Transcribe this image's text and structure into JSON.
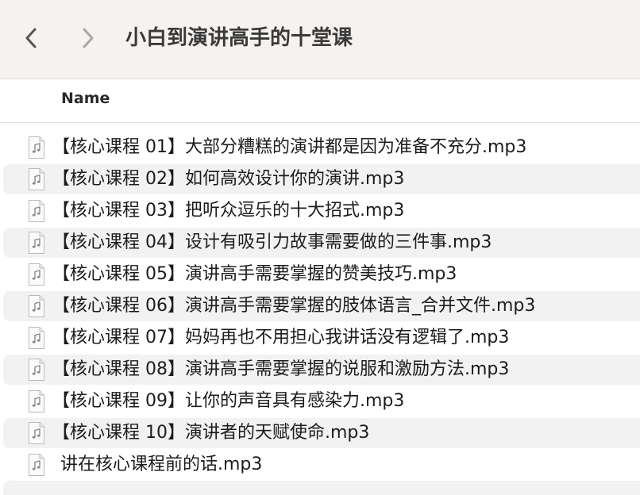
{
  "window": {
    "title": "小白到演讲高手的十堂课"
  },
  "toolbar": {
    "back_icon": "chevron-left-icon",
    "forward_icon": "chevron-right-icon"
  },
  "list_header": {
    "name_label": "Name"
  },
  "files": [
    {
      "name": "【核心课程 01】大部分糟糕的演讲都是因为准备不充分.mp3",
      "icon": "audio-file-icon"
    },
    {
      "name": "【核心课程 02】如何高效设计你的演讲.mp3",
      "icon": "audio-file-icon"
    },
    {
      "name": "【核心课程 03】把听众逗乐的十大招式.mp3",
      "icon": "audio-file-icon"
    },
    {
      "name": "【核心课程 04】设计有吸引力故事需要做的三件事.mp3",
      "icon": "audio-file-icon"
    },
    {
      "name": "【核心课程 05】演讲高手需要掌握的赞美技巧.mp3",
      "icon": "audio-file-icon"
    },
    {
      "name": "【核心课程 06】演讲高手需要掌握的肢体语言_合并文件.mp3",
      "icon": "audio-file-icon"
    },
    {
      "name": "【核心课程 07】妈妈再也不用担心我讲话没有逻辑了.mp3",
      "icon": "audio-file-icon"
    },
    {
      "name": "【核心课程 08】演讲高手需要掌握的说服和激励方法.mp3",
      "icon": "audio-file-icon"
    },
    {
      "name": "【核心课程 09】让你的声音具有感染力.mp3",
      "icon": "audio-file-icon"
    },
    {
      "name": "【核心课程 10】演讲者的天赋使命.mp3",
      "icon": "audio-file-icon"
    },
    {
      "name": "讲在核心课程前的话.mp3",
      "icon": "audio-file-icon"
    }
  ],
  "colors": {
    "toolbar_bg": "#f6f2ef",
    "alt_row_bg": "#f2f2f2",
    "text": "#1c1c1c"
  }
}
